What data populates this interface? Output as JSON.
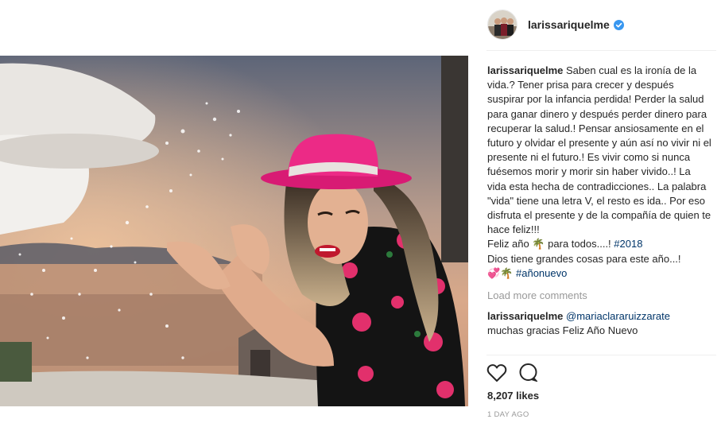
{
  "post": {
    "username": "larissariquelme",
    "verified": true,
    "image_alt": "Woman in a pink hat splashing water from a fountain at sunset"
  },
  "caption": {
    "username": "larissariquelme",
    "text": "Saben cual es la ironía de la vida.? Tener prisa para crecer y después suspirar por la infancia perdida! Perder la salud para ganar dinero y después perder dinero para recuperar la salud.! Pensar ansiosamente en el futuro y olvidar el presente y aún así no vivir ni el presente ni el futuro.! Es vivir como si nunca fuésemos morir y morir sin haber vivido..! La vida esta hecha de contradicciones.. La palabra \"vida\" tiene una letra V, el resto es ida.. Por eso disfruta el presente y de la compañía de quien te hace feliz!!!",
    "line2_prefix": "Feliz año ",
    "palm_emoji": "🌴",
    "line2_suffix": " para todos....! ",
    "hashtag1": "#2018",
    "line3": "Dios tiene grandes cosas para este año...!",
    "emoji_prefix": "💞🌴 ",
    "hashtag2": "#añonuevo"
  },
  "load_more": "Load more comments",
  "comment": {
    "username": "larissariquelme",
    "mention": "@mariaclararuizzarate",
    "text": "muchas gracias Feliz Año Nuevo"
  },
  "actions": {
    "like_icon": "heart-icon",
    "comment_icon": "comment-bubble-icon"
  },
  "likes": "8,207 likes",
  "time": "1 DAY AGO",
  "colors": {
    "link": "#003569",
    "muted": "#999999",
    "verified": "#3897f0",
    "hat": "#e6217f"
  }
}
